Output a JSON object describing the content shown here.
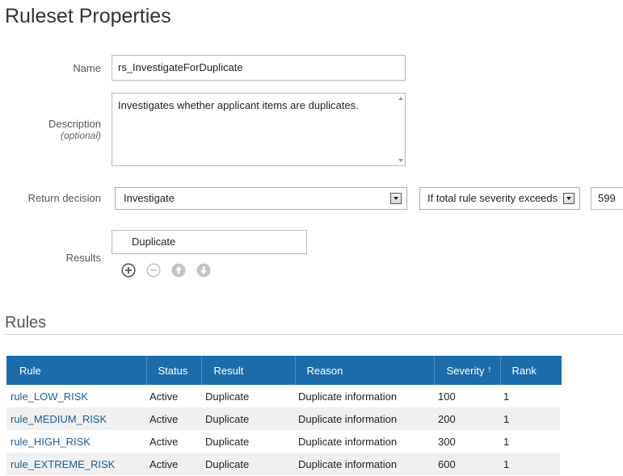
{
  "page": {
    "title": "Ruleset Properties"
  },
  "form": {
    "name_label": "Name",
    "name_value": "rs_InvestigateForDuplicate",
    "description_label": "Description",
    "description_optional": "(optional)",
    "description_value": "Investigates whether applicant items are duplicates.",
    "return_decision_label": "Return decision",
    "return_decision_value": "Investigate",
    "condition_value": "If total rule severity exceeds",
    "threshold_value": "599",
    "results_label": "Results",
    "results_item": "Duplicate"
  },
  "icons": {
    "add": "add-circle-icon",
    "remove": "remove-circle-icon",
    "up": "arrow-up-circle-icon",
    "down": "arrow-down-circle-icon"
  },
  "rules_section": {
    "title": "Rules",
    "columns": [
      "Rule",
      "Status",
      "Result",
      "Reason",
      "Severity",
      "Rank"
    ],
    "sort_indicator": "↑",
    "rows": [
      {
        "rule": "rule_LOW_RISK",
        "status": "Active",
        "result": "Duplicate",
        "reason": "Duplicate information",
        "severity": "100",
        "rank": "1"
      },
      {
        "rule": "rule_MEDIUM_RISK",
        "status": "Active",
        "result": "Duplicate",
        "reason": "Duplicate information",
        "severity": "200",
        "rank": "1"
      },
      {
        "rule": "rule_HIGH_RISK",
        "status": "Active",
        "result": "Duplicate",
        "reason": "Duplicate information",
        "severity": "300",
        "rank": "1"
      },
      {
        "rule": "rule_EXTREME_RISK",
        "status": "Active",
        "result": "Duplicate",
        "reason": "Duplicate information",
        "severity": "600",
        "rank": "1"
      }
    ]
  },
  "colors": {
    "table_header": "#1c6cab",
    "link": "#1a5e96",
    "alt_row": "#f0f0f0"
  }
}
